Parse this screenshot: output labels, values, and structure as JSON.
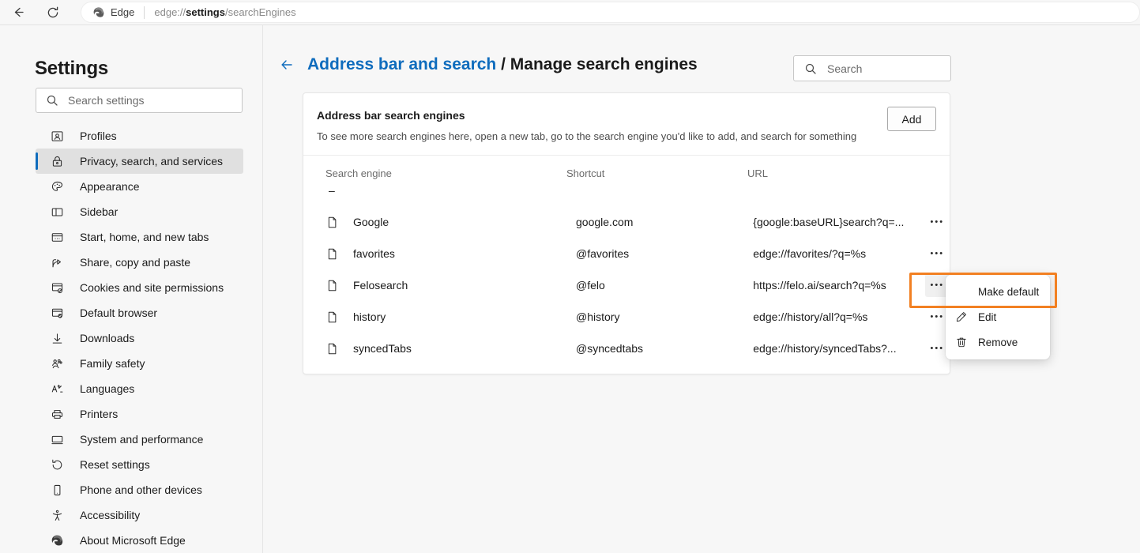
{
  "browser": {
    "back_icon": "arrow-left-icon",
    "reload_icon": "reload-icon",
    "brand_label": "Edge",
    "brand_icon": "edge-logo-icon",
    "url_prefix": "edge://",
    "url_bold": "settings",
    "url_suffix": "/searchEngines"
  },
  "sidebar": {
    "title": "Settings",
    "search": {
      "placeholder": "Search settings",
      "value": "",
      "icon": "search-icon"
    },
    "items": [
      {
        "label": "Profiles",
        "icon": "profile-icon",
        "active": false
      },
      {
        "label": "Privacy, search, and services",
        "icon": "lock-icon",
        "active": true
      },
      {
        "label": "Appearance",
        "icon": "palette-icon",
        "active": false
      },
      {
        "label": "Sidebar",
        "icon": "sidebar-icon",
        "active": false
      },
      {
        "label": "Start, home, and new tabs",
        "icon": "window-dots-icon",
        "active": false
      },
      {
        "label": "Share, copy and paste",
        "icon": "share-icon",
        "active": false
      },
      {
        "label": "Cookies and site permissions",
        "icon": "cookie-icon",
        "active": false
      },
      {
        "label": "Default browser",
        "icon": "default-browser-icon",
        "active": false
      },
      {
        "label": "Downloads",
        "icon": "download-icon",
        "active": false
      },
      {
        "label": "Family safety",
        "icon": "family-icon",
        "active": false
      },
      {
        "label": "Languages",
        "icon": "language-icon",
        "active": false
      },
      {
        "label": "Printers",
        "icon": "printer-icon",
        "active": false
      },
      {
        "label": "System and performance",
        "icon": "monitor-icon",
        "active": false
      },
      {
        "label": "Reset settings",
        "icon": "reset-icon",
        "active": false
      },
      {
        "label": "Phone and other devices",
        "icon": "phone-icon",
        "active": false
      },
      {
        "label": "Accessibility",
        "icon": "accessibility-icon",
        "active": false
      },
      {
        "label": "About Microsoft Edge",
        "icon": "edge-logo-icon",
        "active": false
      }
    ]
  },
  "main": {
    "back_icon": "arrow-left-icon",
    "breadcrumb": {
      "parent": "Address bar and search",
      "separator": " / ",
      "current": "Manage search engines"
    },
    "search": {
      "placeholder": "Search",
      "value": "",
      "icon": "search-icon"
    },
    "card": {
      "title": "Address bar search engines",
      "subtitle": "To see more search engines here, open a new tab, go to the search engine you'd like to add, and search for something",
      "add_label": "Add",
      "columns": {
        "engine": "Search engine",
        "shortcut": "Shortcut",
        "url": "URL"
      },
      "default_placeholder": "–",
      "rows": [
        {
          "icon": "file-icon",
          "name": "Google",
          "shortcut": "google.com",
          "url": "{google:baseURL}search?q=...",
          "more_icon": "more-horizontal-icon",
          "menu_open": false
        },
        {
          "icon": "file-icon",
          "name": "favorites",
          "shortcut": "@favorites",
          "url": "edge://favorites/?q=%s",
          "more_icon": "more-horizontal-icon",
          "menu_open": false
        },
        {
          "icon": "file-icon",
          "name": "Felosearch",
          "shortcut": "@felo",
          "url": "https://felo.ai/search?q=%s",
          "more_icon": "more-horizontal-icon",
          "menu_open": true
        },
        {
          "icon": "file-icon",
          "name": "history",
          "shortcut": "@history",
          "url": "edge://history/all?q=%s",
          "more_icon": "more-horizontal-icon",
          "menu_open": false
        },
        {
          "icon": "file-icon",
          "name": "syncedTabs",
          "shortcut": "@syncedtabs",
          "url": "edge://history/syncedTabs?...",
          "more_icon": "more-horizontal-icon",
          "menu_open": false
        }
      ]
    }
  },
  "context_menu": {
    "items": [
      {
        "label": "Make default",
        "icon": "",
        "highlighted": true
      },
      {
        "label": "Edit",
        "icon": "pencil-icon",
        "highlighted": false
      },
      {
        "label": "Remove",
        "icon": "trash-icon",
        "highlighted": false
      }
    ]
  },
  "colors": {
    "accent_blue": "#0f6cbd",
    "highlight_orange": "#f28022",
    "page_background": "#f7f7f7",
    "card_background": "#ffffff",
    "active_nav_background": "#e0e0e0",
    "text_primary": "#1b1b1b",
    "text_secondary": "#6b6b6b"
  }
}
